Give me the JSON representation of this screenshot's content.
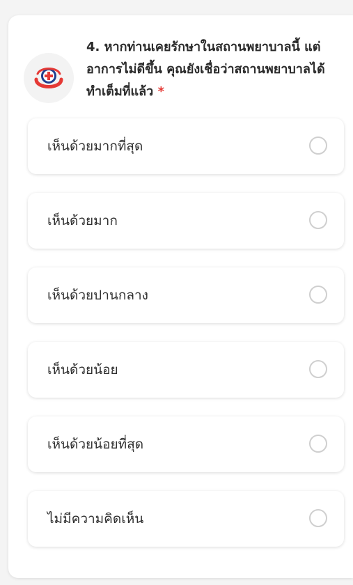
{
  "question": {
    "text": "4. หากท่านเคยรักษาในสถานพยาบาลนี้ แต่อาการไม่ดีขึ้น คุณยังเชื่อว่าสถานพยาบาลได้ทำเต็มที่แล้ว",
    "required_marker": "*",
    "logo_icon": "hospital-cross-logo"
  },
  "options": [
    {
      "label": "เห็นด้วยมากที่สุด",
      "selected": false
    },
    {
      "label": "เห็นด้วยมาก",
      "selected": false
    },
    {
      "label": "เห็นด้วยปานกลาง",
      "selected": false
    },
    {
      "label": "เห็นด้วยน้อย",
      "selected": false
    },
    {
      "label": "เห็นด้วยน้อยที่สุด",
      "selected": false
    },
    {
      "label": "ไม่มีความคิดเห็น",
      "selected": false
    }
  ],
  "colors": {
    "required": "#e53935",
    "logo_blue": "#1f3f8f",
    "logo_red": "#e53935"
  }
}
